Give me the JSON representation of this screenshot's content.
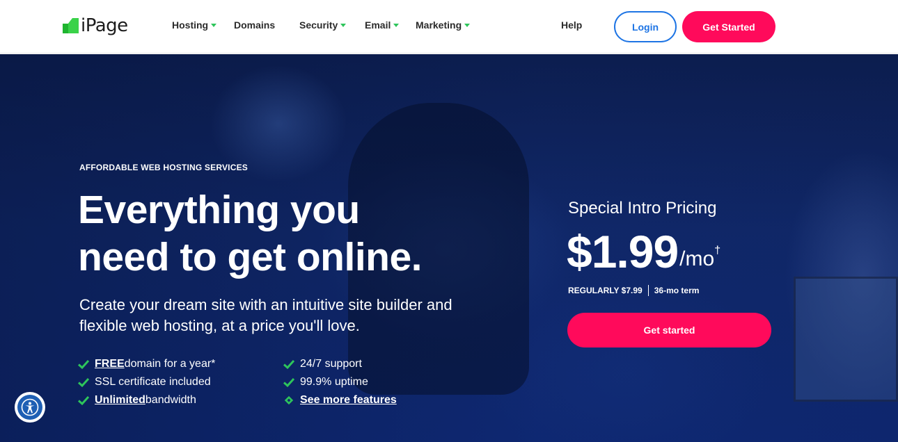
{
  "header": {
    "logo_text": "iPage",
    "nav": [
      {
        "label": "Hosting",
        "has_caret": true
      },
      {
        "label": "Domains",
        "has_caret": false
      },
      {
        "label": "Security",
        "has_caret": true
      },
      {
        "label": "Email",
        "has_caret": true
      },
      {
        "label": "Marketing",
        "has_caret": true
      },
      {
        "label": "Help",
        "has_caret": false
      }
    ],
    "login_label": "Login",
    "get_started_label": "Get Started"
  },
  "hero": {
    "eyebrow": "AFFORDABLE WEB HOSTING SERVICES",
    "headline_line1": "Everything you",
    "headline_line2": "need to get online.",
    "subtext": "Create your dream site with an intuitive site builder and flexible web hosting, at a price you'll love.",
    "features_left": [
      {
        "emphasis": "FREE ",
        "text": "domain for a year*"
      },
      {
        "emphasis": "",
        "text": "SSL certificate included"
      },
      {
        "emphasis": "Unlimited ",
        "text": "bandwidth"
      }
    ],
    "features_right": [
      {
        "text": "24/7 support"
      },
      {
        "text": "99.9% uptime"
      },
      {
        "text": "See more features"
      }
    ],
    "pricing": {
      "label": "Special Intro Pricing",
      "amount": "$1.99",
      "unit": "/mo",
      "dagger": "†",
      "regular": "REGULARLY $7.99",
      "term": "36-mo term",
      "cta_label": "Get started"
    }
  },
  "colors": {
    "accent_pink": "#ff0a5b",
    "accent_blue": "#1d74e4",
    "check_green": "#2ec55b",
    "hero_bg": "#0f2a6e"
  },
  "icons": {
    "logo": "ipage-logo-icon",
    "check": "check-icon",
    "more": "diamond-icon",
    "accessibility": "accessibility-icon"
  }
}
